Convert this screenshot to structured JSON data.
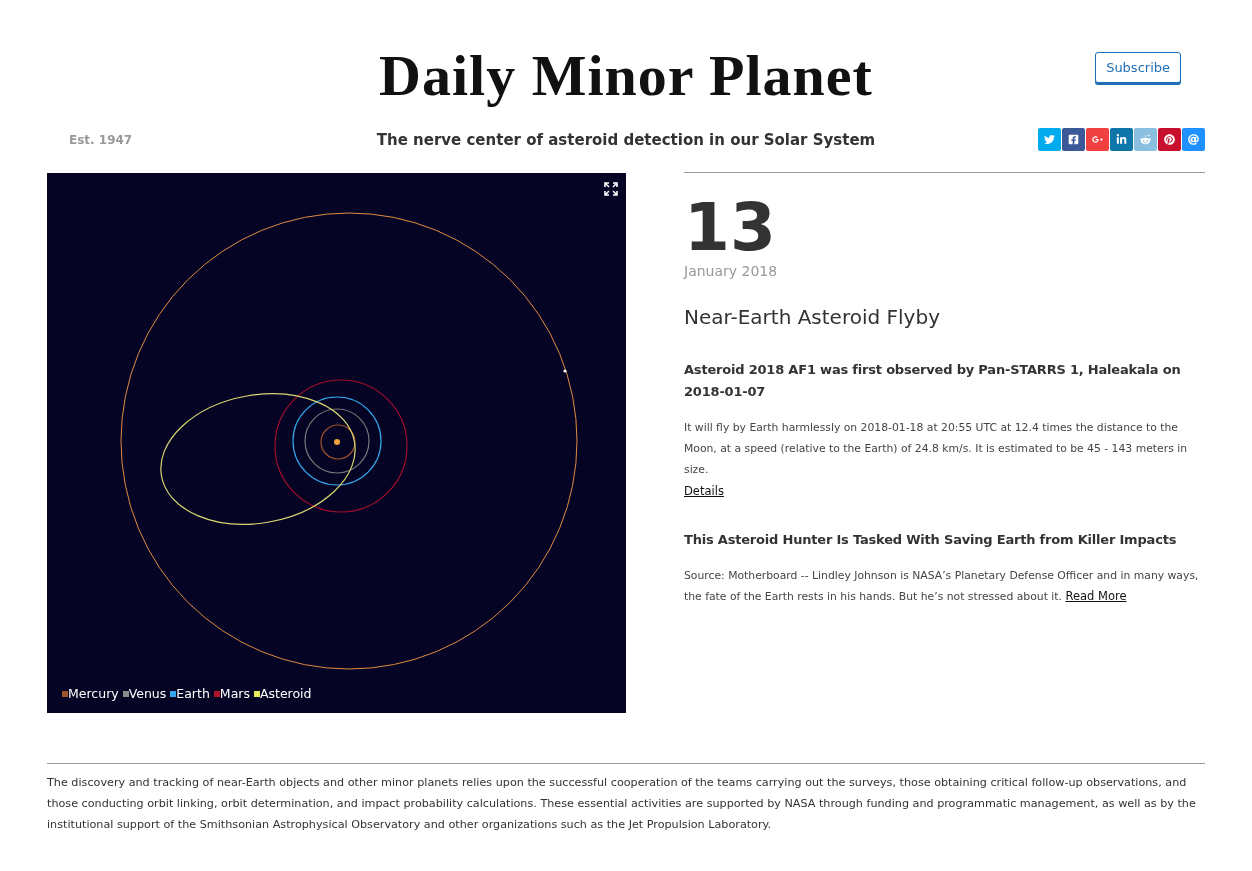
{
  "masthead": {
    "title": "Daily Minor Planet",
    "subscribe": "Subscribe",
    "established": "Est. 1947",
    "tagline": "The nerve center of asteroid detection in our Solar System"
  },
  "share_buttons": [
    {
      "kind": "twitter"
    },
    {
      "kind": "facebook"
    },
    {
      "kind": "googleplus"
    },
    {
      "kind": "linkedin"
    },
    {
      "kind": "reddit"
    },
    {
      "kind": "pinterest"
    },
    {
      "kind": "email"
    }
  ],
  "orbit_view": {
    "legend": [
      {
        "label": "Mercury",
        "color": "#a0522d"
      },
      {
        "label": "Venus",
        "color": "#8a8a8a"
      },
      {
        "label": "Earth",
        "color": "#35a7ee"
      },
      {
        "label": "Mars",
        "color": "#b3132a"
      },
      {
        "label": "Asteroid",
        "color": "#e8e85a"
      }
    ]
  },
  "date": {
    "day": "13",
    "month_year": "January 2018"
  },
  "section_title": "Near-Earth Asteroid Flyby",
  "articles": [
    {
      "headline": "Asteroid 2018 AF1 was first observed by Pan-STARRS 1, Haleakala on 2018-01-07",
      "body": "It will fly by Earth harmlessly on 2018-01-18 at 20:55 UTC at 12.4 times the distance to the Moon, at a speed (relative to the Earth) of 24.8 km/s. It is estimated to be 45 - 143 meters in size.",
      "link": "Details",
      "kind": "block_link"
    },
    {
      "headline": "This Asteroid Hunter Is Tasked With Saving Earth from Killer Impacts",
      "body": "Source: Motherboard -- Lindley Johnson is NASA’s Planetary Defense Officer and in many ways, the fate of the Earth rests in his hands. But he’s not stressed about it.",
      "link": "Read More",
      "kind": "inline_link"
    }
  ],
  "footer": "The discovery and tracking of near-Earth objects and other minor planets relies upon the successful cooperation of the teams carrying out the surveys, those obtaining critical follow-up observations, and those conducting orbit linking, orbit determination, and impact probability calculations. These essential activities are supported by NASA through funding and programmatic management, as well as by the institutional support of the Smithsonian Astrophysical Observatory and other organizations such as the Jet Propulsion Laboratory."
}
